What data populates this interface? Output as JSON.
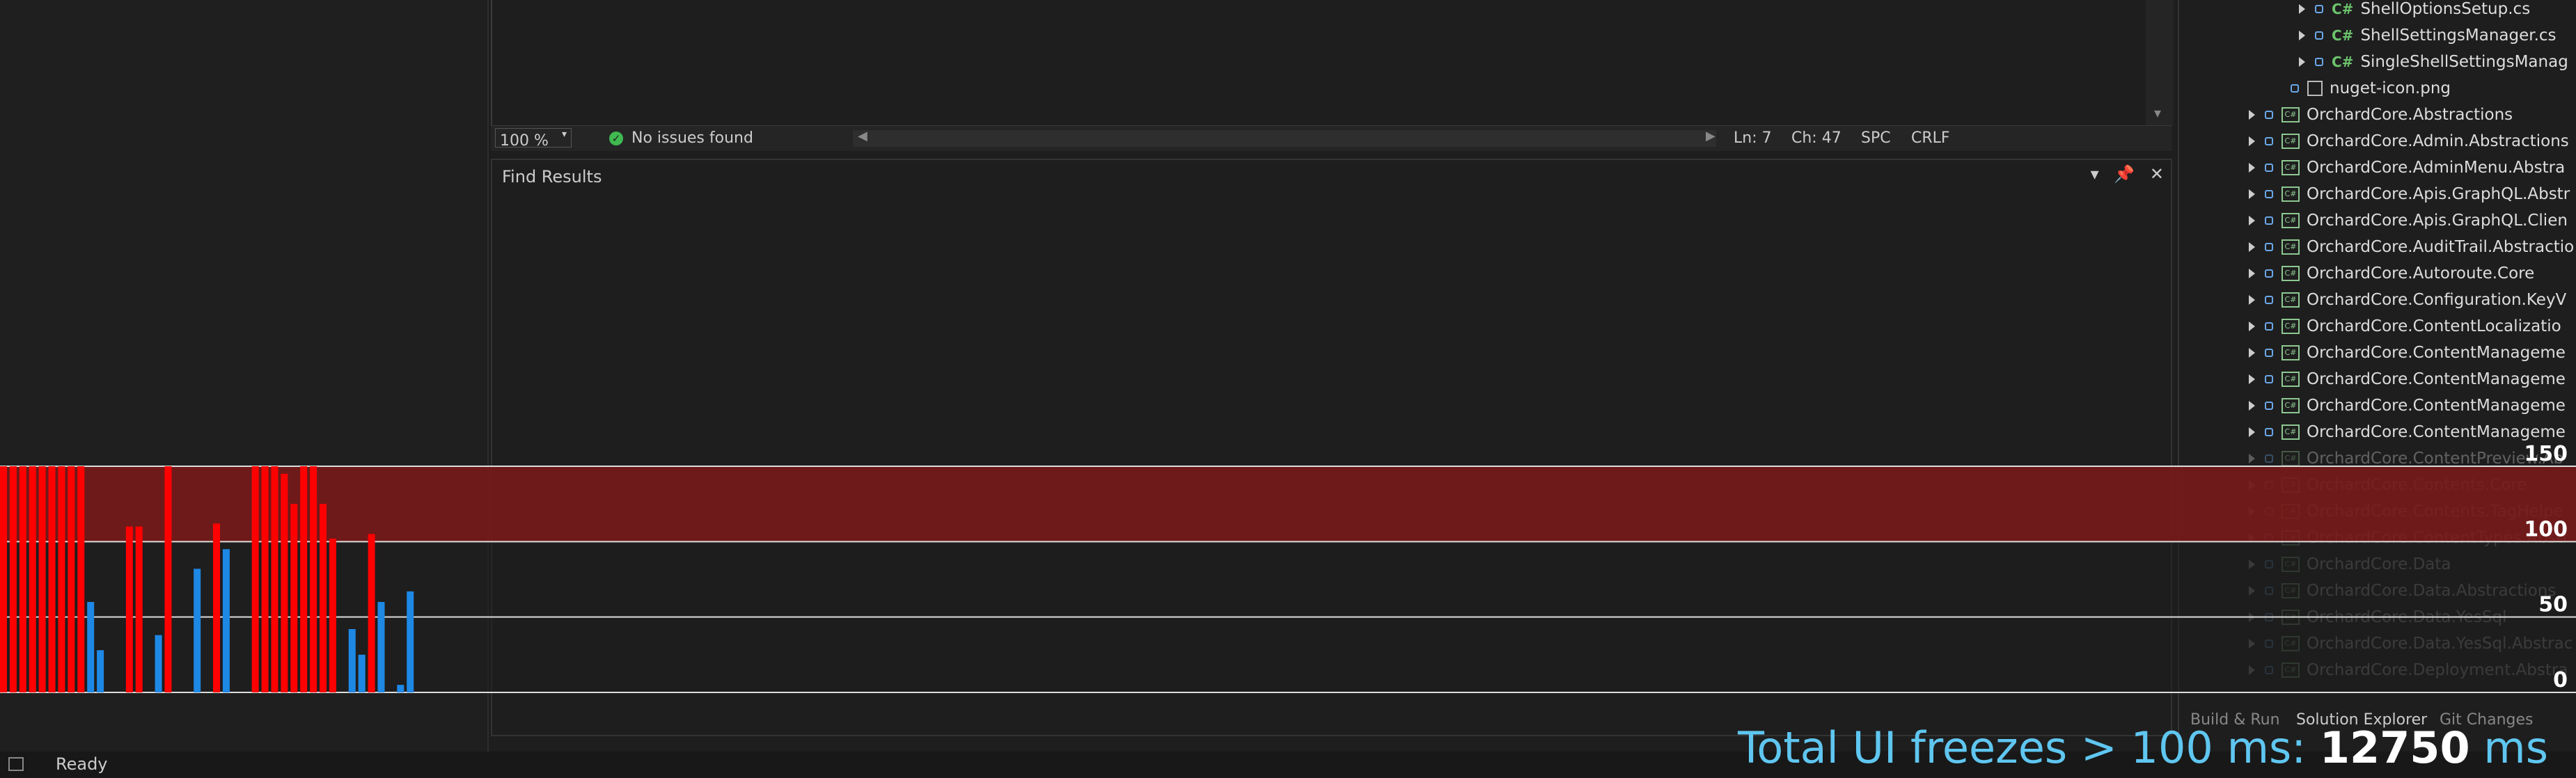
{
  "editor": {
    "zoom": "100 %",
    "issues": "No issues found",
    "line": "Ln: 7",
    "col": "Ch: 47",
    "whitespace": "SPC",
    "line_ending": "CRLF"
  },
  "find_results": {
    "title": "Find Results"
  },
  "solution_explorer": {
    "files": [
      {
        "name": "ShellOptionsSetup.cs"
      },
      {
        "name": "ShellSettingsManager.cs"
      },
      {
        "name": "SingleShellSettingsManag"
      },
      {
        "name": "nuget-icon.png"
      }
    ],
    "projects": [
      "OrchardCore.Abstractions",
      "OrchardCore.Admin.Abstractions",
      "OrchardCore.AdminMenu.Abstra",
      "OrchardCore.Apis.GraphQL.Abstr",
      "OrchardCore.Apis.GraphQL.Clien",
      "OrchardCore.AuditTrail.Abstractio",
      "OrchardCore.Autoroute.Core",
      "OrchardCore.Configuration.KeyV",
      "OrchardCore.ContentLocalizatio",
      "OrchardCore.ContentManageme",
      "OrchardCore.ContentManageme",
      "OrchardCore.ContentManageme",
      "OrchardCore.ContentManageme",
      "OrchardCore.ContentPreview.Ab",
      "OrchardCore.Contents.Core",
      "OrchardCore.Contents.TagHelpe",
      "OrchardCore.ContentTypes.Abstr",
      "OrchardCore.Data",
      "OrchardCore.Data.Abstractions",
      "OrchardCore.Data.YesSql",
      "OrchardCore.Data.YesSql.Abstrac",
      "OrchardCore.Deployment.Abstra"
    ],
    "tabs": [
      "Build & Run",
      "Solution Explorer",
      "Git Changes"
    ]
  },
  "status_bar": {
    "ready": "Ready"
  },
  "overlay": {
    "prefix": "Total UI freezes > 100 ms: ",
    "value": "12750",
    "suffix": " ms"
  },
  "chart_data": {
    "type": "bar",
    "title": "",
    "ylim": [
      0,
      150
    ],
    "yticks": [
      0,
      50,
      100,
      150
    ],
    "threshold": 100,
    "colors": {
      "above": "#ff0000",
      "below": "#1e88e5",
      "band": "#8b1a1a"
    },
    "values": [
      150,
      150,
      150,
      150,
      150,
      150,
      150,
      150,
      150,
      60,
      28,
      0,
      0,
      110,
      110,
      0,
      38,
      150,
      0,
      0,
      82,
      0,
      112,
      95,
      0,
      0,
      150,
      150,
      150,
      145,
      125,
      150,
      150,
      125,
      102,
      0,
      42,
      25,
      105,
      60,
      0,
      5,
      67,
      0,
      0,
      0,
      0,
      0,
      0,
      0,
      0,
      0,
      0,
      0,
      0,
      0,
      0,
      0,
      0,
      0,
      0,
      0,
      0,
      0,
      0,
      0,
      0,
      0,
      0,
      0,
      0,
      0,
      0,
      0,
      0,
      0,
      0,
      0,
      0,
      0,
      0,
      0,
      0,
      0,
      0,
      0,
      0,
      0,
      0,
      0,
      0,
      0,
      0,
      0,
      0,
      0,
      0,
      0,
      0,
      0,
      0,
      0,
      0,
      0,
      0,
      0,
      0,
      0,
      0,
      0,
      0,
      0,
      0,
      0,
      0,
      0,
      0,
      0,
      0,
      0,
      0,
      0,
      0,
      0,
      0,
      0,
      0,
      0,
      0,
      0,
      0,
      0,
      0,
      0,
      0,
      0,
      0,
      0,
      0,
      0,
      0,
      0,
      0,
      0,
      0,
      0,
      0,
      0,
      0,
      0,
      0,
      0,
      0,
      0,
      0,
      0,
      0,
      0,
      0,
      0,
      0,
      0,
      0,
      0,
      0,
      0,
      0,
      0,
      0,
      0,
      0,
      0,
      0,
      0,
      0,
      0,
      0,
      0,
      0,
      0,
      0,
      0,
      0,
      0,
      0,
      0,
      0,
      0,
      0,
      0,
      0,
      0,
      0,
      0,
      0,
      0,
      0,
      0,
      0,
      0,
      0,
      0,
      0,
      0,
      0,
      0,
      0,
      0,
      0,
      0,
      0,
      0,
      0,
      0,
      0,
      0,
      0,
      0,
      0,
      0,
      0,
      0,
      0,
      0,
      0,
      0,
      0,
      0,
      0,
      0,
      0,
      0,
      0,
      0,
      0,
      0,
      0,
      0,
      0,
      0,
      0,
      0,
      0,
      0,
      0,
      0,
      0,
      0,
      0,
      0,
      0,
      0,
      0,
      0,
      0,
      0,
      0,
      0,
      0,
      0,
      0,
      0,
      0,
      0,
      0,
      0
    ]
  }
}
